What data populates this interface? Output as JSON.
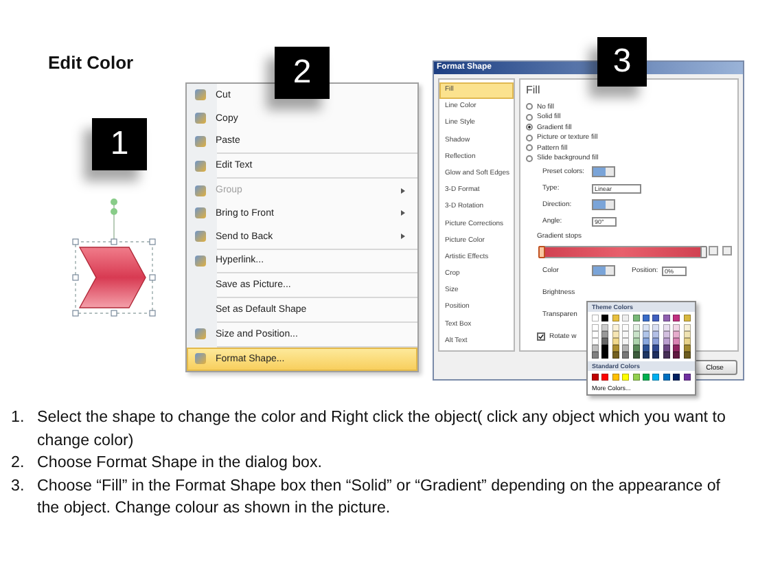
{
  "title": "Edit Color",
  "step_badges": [
    "1",
    "2",
    "3"
  ],
  "context_menu": {
    "groups": [
      {
        "items": [
          {
            "label": "Cut",
            "has_icon": true,
            "disabled": false,
            "submenu": false,
            "selected": false
          },
          {
            "label": "Copy",
            "has_icon": true,
            "disabled": false,
            "submenu": false,
            "selected": false
          },
          {
            "label": "Paste",
            "has_icon": true,
            "disabled": false,
            "submenu": false,
            "selected": false
          }
        ]
      },
      {
        "items": [
          {
            "label": "Edit Text",
            "has_icon": true,
            "disabled": false,
            "submenu": false,
            "selected": false
          }
        ]
      },
      {
        "items": [
          {
            "label": "Group",
            "has_icon": true,
            "disabled": true,
            "submenu": true,
            "selected": false
          },
          {
            "label": "Bring to Front",
            "has_icon": true,
            "disabled": false,
            "submenu": true,
            "selected": false
          },
          {
            "label": "Send to Back",
            "has_icon": true,
            "disabled": false,
            "submenu": true,
            "selected": false
          }
        ]
      },
      {
        "items": [
          {
            "label": "Hyperlink...",
            "has_icon": true,
            "disabled": false,
            "submenu": false,
            "selected": false
          }
        ]
      },
      {
        "items": [
          {
            "label": "Save as Picture...",
            "has_icon": false,
            "disabled": false,
            "submenu": false,
            "selected": false
          }
        ]
      },
      {
        "items": [
          {
            "label": "Set as Default Shape",
            "has_icon": false,
            "disabled": false,
            "submenu": false,
            "selected": false
          }
        ]
      },
      {
        "items": [
          {
            "label": "Size and Position...",
            "has_icon": true,
            "disabled": false,
            "submenu": false,
            "selected": false
          }
        ]
      },
      {
        "items": [
          {
            "label": "Format Shape...",
            "has_icon": true,
            "disabled": false,
            "submenu": false,
            "selected": true
          }
        ]
      }
    ]
  },
  "dialog": {
    "title": "Format Shape",
    "nav": [
      {
        "label": "Fill",
        "selected": true
      },
      {
        "label": "Line Color",
        "selected": false
      },
      {
        "label": "Line Style",
        "selected": false
      },
      {
        "label": "Shadow",
        "selected": false
      },
      {
        "label": "Reflection",
        "selected": false
      },
      {
        "label": "Glow and Soft Edges",
        "selected": false
      },
      {
        "label": "3-D Format",
        "selected": false
      },
      {
        "label": "3-D Rotation",
        "selected": false
      },
      {
        "label": "Picture Corrections",
        "selected": false
      },
      {
        "label": "Picture Color",
        "selected": false
      },
      {
        "label": "Artistic Effects",
        "selected": false
      },
      {
        "label": "Crop",
        "selected": false
      },
      {
        "label": "Size",
        "selected": false
      },
      {
        "label": "Position",
        "selected": false
      },
      {
        "label": "Text Box",
        "selected": false
      },
      {
        "label": "Alt Text",
        "selected": false
      }
    ],
    "section_title": "Fill",
    "fill_options": [
      {
        "label": "No fill",
        "selected": false
      },
      {
        "label": "Solid fill",
        "selected": false
      },
      {
        "label": "Gradient fill",
        "selected": true
      },
      {
        "label": "Picture or texture fill",
        "selected": false
      },
      {
        "label": "Pattern fill",
        "selected": false
      },
      {
        "label": "Slide background fill",
        "selected": false
      }
    ],
    "fields": [
      {
        "label": "Preset colors:",
        "kind": "swatch"
      },
      {
        "label": "Type:",
        "kind": "select",
        "value": "Linear"
      },
      {
        "label": "Direction:",
        "kind": "swatch"
      },
      {
        "label": "Angle:",
        "kind": "spinner",
        "value": "90°"
      }
    ],
    "gradient_stops_label": "Gradient stops",
    "gradient_stops": [
      {
        "level": 0,
        "selected": true
      },
      {
        "level": 1,
        "selected": false
      }
    ],
    "color_label": "Color",
    "position_label": "Position:",
    "position_value": "0%",
    "brightness_label": "Brightness",
    "transparency_label": "Transparen",
    "rotate": {
      "label": "Rotate w",
      "checked": true
    },
    "close_button": "Close",
    "palette": {
      "theme_title": "Theme Colors",
      "theme_colors": [
        {
          "color": "#ffffff"
        },
        {
          "color": "#000000"
        },
        {
          "color": "#e8c040"
        },
        {
          "color": "#eeeeee"
        },
        {
          "color": "#78b878"
        },
        {
          "color": "#3a6cc8"
        },
        {
          "color": "#4060c0"
        },
        {
          "color": "#9060b0"
        },
        {
          "color": "#c03080"
        },
        {
          "color": "#d8b840"
        }
      ],
      "standard_title": "Standard Colors",
      "standard_colors": [
        {
          "color": "#c00000"
        },
        {
          "color": "#ff0000"
        },
        {
          "color": "#ffc000"
        },
        {
          "color": "#ffff00"
        },
        {
          "color": "#92d050"
        },
        {
          "color": "#00b050"
        },
        {
          "color": "#00b0f0"
        },
        {
          "color": "#0070c0"
        },
        {
          "color": "#002060"
        },
        {
          "color": "#7030a0"
        }
      ],
      "more": "More Colors..."
    }
  },
  "steps": [
    {
      "number": "1.",
      "text": "Select the shape to change the color and Right click the object( click any object which you want to change color)"
    },
    {
      "number": "2.",
      "text": "Choose Format Shape in the dialog box."
    },
    {
      "number": "3.",
      "text": "Choose “Fill” in the Format Shape box then “Solid” or “Gradient” depending on the appearance of the object. Change colour as shown in the picture."
    }
  ]
}
